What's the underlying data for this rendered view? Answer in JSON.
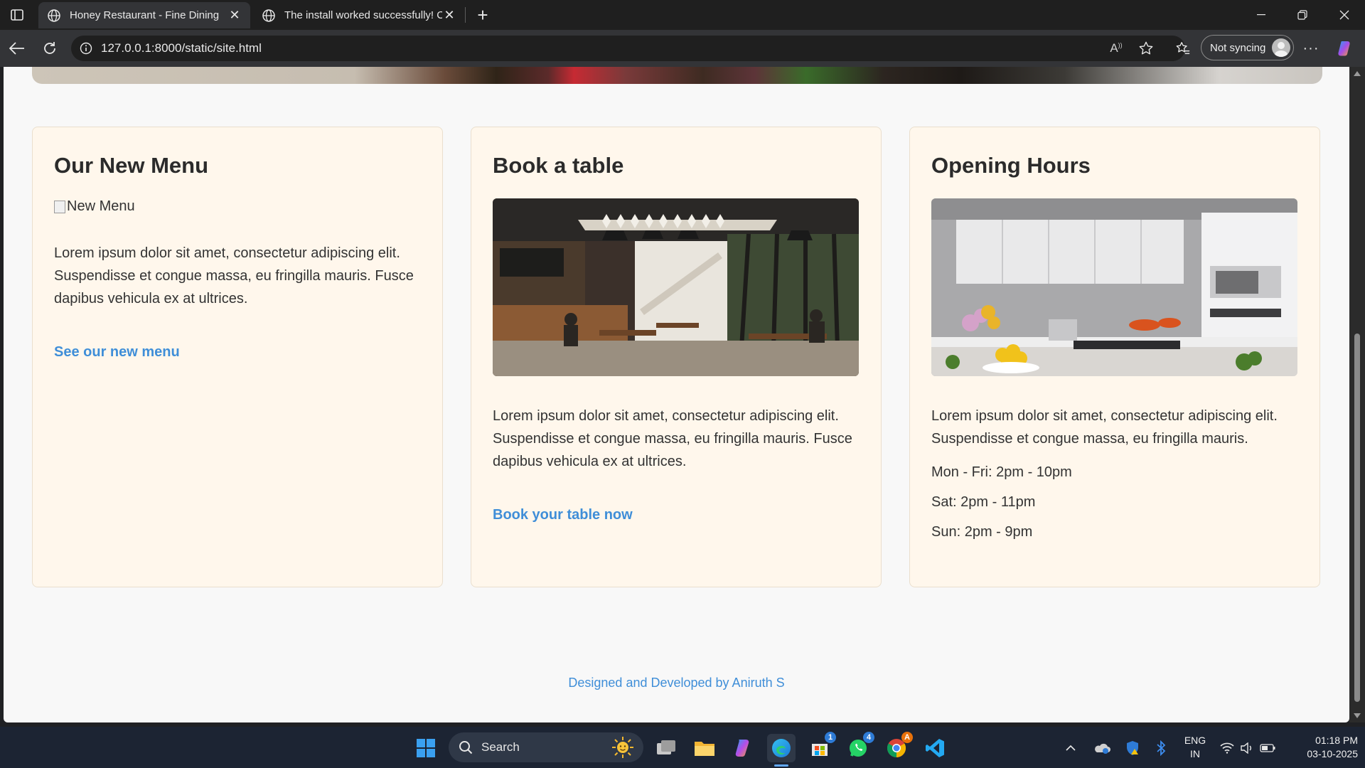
{
  "browser": {
    "tabs": [
      {
        "title": "Honey Restaurant - Fine Dining",
        "active": true
      },
      {
        "title": "The install worked successfully! Co",
        "active": false
      }
    ],
    "url": "127.0.0.1:8000/static/site.html",
    "sync_label": "Not syncing"
  },
  "page": {
    "cards": [
      {
        "title": "Our New Menu",
        "image_alt": "New Menu",
        "text": "Lorem ipsum dolor sit amet, consectetur adipiscing elit. Suspendisse et congue massa, eu fringilla mauris. Fusce dapibus vehicula ex at ultrices.",
        "link": "See our new menu"
      },
      {
        "title": "Book a table",
        "text": "Lorem ipsum dolor sit amet, consectetur adipiscing elit. Suspendisse et congue massa, eu fringilla mauris. Fusce dapibus vehicula ex at ultrices.",
        "link": "Book your table now"
      },
      {
        "title": "Opening Hours",
        "text": "Lorem ipsum dolor sit amet, consectetur adipiscing elit. Suspendisse et congue massa, eu fringilla mauris.",
        "hours": [
          "Mon - Fri: 2pm - 10pm",
          "Sat: 2pm - 11pm",
          "Sun: 2pm - 9pm"
        ]
      }
    ],
    "footer": "Designed and Developed by Aniruth S"
  },
  "taskbar": {
    "search_label": "Search",
    "store_badge": "1",
    "whatsapp_badge": "4",
    "chrome_badge": "A",
    "language": "ENG",
    "region": "IN",
    "time": "01:18 PM",
    "date": "03-10-2025"
  },
  "colors": {
    "link": "#3f8ed8",
    "card_bg": "#fff7ec",
    "page_bg": "#f8f8f8"
  }
}
